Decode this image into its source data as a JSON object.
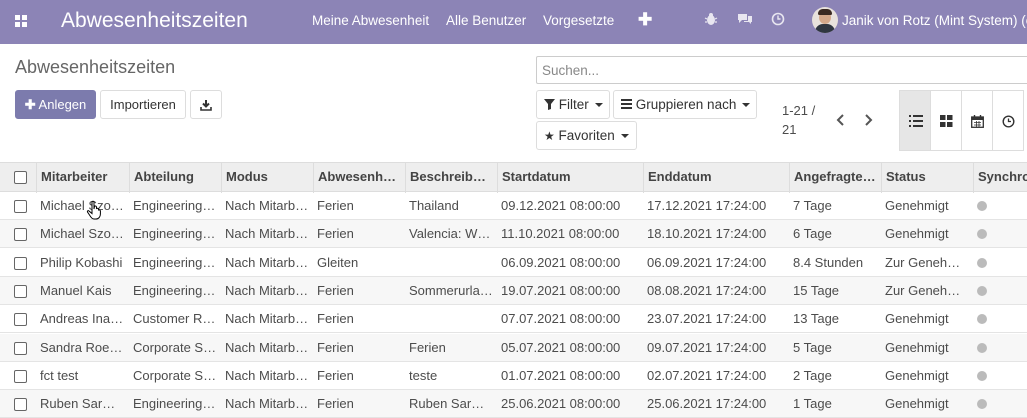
{
  "topbar": {
    "app_title": "Abwesenheitszeiten",
    "menu": [
      "Meine Abwesenheit",
      "Alle Benutzer",
      "Vorgesetzte"
    ],
    "plus_label": "✚",
    "icons": [
      "apps-grid-icon",
      "bug-icon",
      "chat-icon",
      "clock-icon"
    ],
    "user_name": "Janik von Rotz (Mint System) (cp"
  },
  "control_panel": {
    "breadcrumb": "Abwesenheitszeiten",
    "create_label": "Anlegen",
    "import_label": "Importieren",
    "search_placeholder": "Suchen...",
    "filter_label": "Filter",
    "group_by_label": "Gruppieren nach",
    "favorites_label": "Favoriten",
    "pager_value": "1-21 /",
    "pager_total": "21",
    "views": [
      "list-view-icon",
      "kanban-view-icon",
      "calendar-view-icon",
      "activity-view-icon"
    ]
  },
  "table": {
    "columns": [
      "Mitarbeiter",
      "Abteilung",
      "Modus",
      "Abwesenh…",
      "Beschreib…",
      "Startdatum",
      "Enddatum",
      "Angefragte…",
      "Status",
      "Synchro"
    ],
    "rows": [
      [
        "Michael Szo…",
        "Engineering…",
        "Nach Mitarb…",
        "Ferien",
        "Thailand",
        "09.12.2021 08:00:00",
        "17.12.2021 17:24:00",
        "7 Tage",
        "Genehmigt"
      ],
      [
        "Michael Szo…",
        "Engineering…",
        "Nach Mitarb…",
        "Ferien",
        "Valencia: W…",
        "11.10.2021 08:00:00",
        "18.10.2021 17:24:00",
        "6 Tage",
        "Genehmigt"
      ],
      [
        "Philip Kobashi",
        "Engineering…",
        "Nach Mitarb…",
        "Gleiten",
        "",
        "06.09.2021 08:00:00",
        "06.09.2021 17:24:00",
        "8.4 Stunden",
        "Zur Geneh…"
      ],
      [
        "Manuel Kais",
        "Engineering…",
        "Nach Mitarb…",
        "Ferien",
        "Sommerurla…",
        "19.07.2021 08:00:00",
        "08.08.2021 17:24:00",
        "15 Tage",
        "Zur Geneh…"
      ],
      [
        "Andreas Ina…",
        "Customer R…",
        "Nach Mitarb…",
        "Ferien",
        "",
        "07.07.2021 08:00:00",
        "23.07.2021 17:24:00",
        "13 Tage",
        "Genehmigt"
      ],
      [
        "Sandra Roe…",
        "Corporate S…",
        "Nach Mitarb…",
        "Ferien",
        "Ferien",
        "05.07.2021 08:00:00",
        "09.07.2021 17:24:00",
        "5 Tage",
        "Genehmigt"
      ],
      [
        "fct test",
        "Corporate S…",
        "Nach Mitarb…",
        "Ferien",
        "teste",
        "01.07.2021 08:00:00",
        "02.07.2021 17:24:00",
        "2 Tage",
        "Genehmigt"
      ],
      [
        "Ruben Sar…",
        "Engineering…",
        "Nach Mitarb…",
        "Ferien",
        "Ruben Sar…",
        "25.06.2021 08:00:00",
        "25.06.2021 17:24:00",
        "1 Tage",
        "Genehmigt"
      ]
    ]
  },
  "colors": {
    "topbar": "#8c84b6",
    "primary_button": "#7c7bad",
    "sync_dot": "#bbbbbb"
  }
}
